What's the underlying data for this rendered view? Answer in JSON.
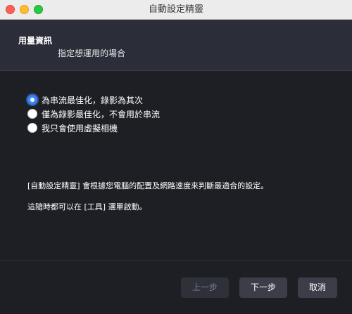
{
  "window": {
    "title": "自動設定精靈"
  },
  "header": {
    "title": "用量資訊",
    "subtitle": "指定想運用的場合"
  },
  "options": [
    {
      "label": "為串流最佳化，錄影為其次",
      "selected": true
    },
    {
      "label": "僅為錄影最佳化，不會用於串流",
      "selected": false
    },
    {
      "label": "我只會使用虛擬相機",
      "selected": false
    }
  ],
  "info": {
    "line1": "[自動設定精靈] 會根據您電腦的配置及網路速度來判斷最適合的設定。",
    "line2": "這隨時都可以在 [工具] 選單啟動。"
  },
  "buttons": {
    "prev": "上一步",
    "next": "下一步",
    "cancel": "取消"
  },
  "colors": {
    "accent": "#3a82f7",
    "background": "#1e1f25",
    "header_background": "#2b2e38"
  }
}
